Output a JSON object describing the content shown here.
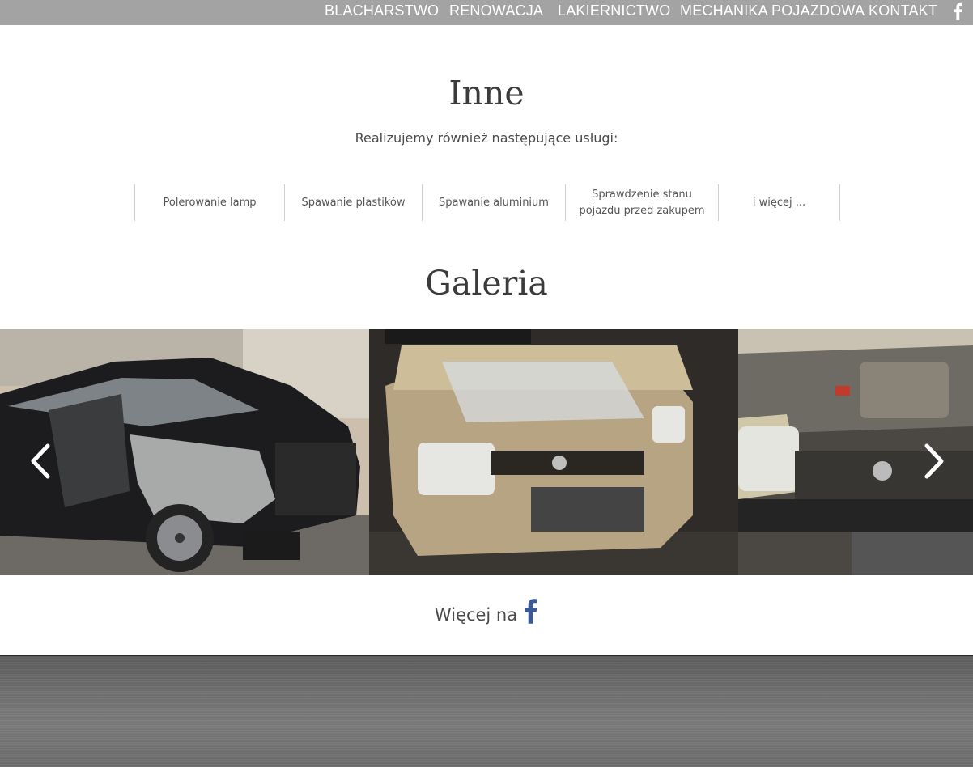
{
  "nav": {
    "items": [
      "BLACHARSTWO",
      "RENOWACJA",
      "LAKIERNICTWO",
      "MECHANIKA POJAZDOWA",
      "KONTAKT"
    ],
    "facebook_icon": "facebook-icon"
  },
  "inne": {
    "title": "Inne",
    "subtitle": "Realizujemy również następujące usługi:",
    "services": [
      "Polerowanie lamp",
      "Spawanie plastików",
      "Spawanie aluminium",
      "Sprawdzenie stanu pojazdu przed zakupem",
      "i więcej ..."
    ]
  },
  "gallery": {
    "title": "Galeria",
    "prev_icon": "chevron-left-icon",
    "next_icon": "chevron-right-icon"
  },
  "more": {
    "label": "Więcej na",
    "icon": "facebook-icon",
    "icon_color": "#3b5998"
  },
  "colors": {
    "nav_bg": "#a3a3a3",
    "heading": "#3b3b3b"
  }
}
